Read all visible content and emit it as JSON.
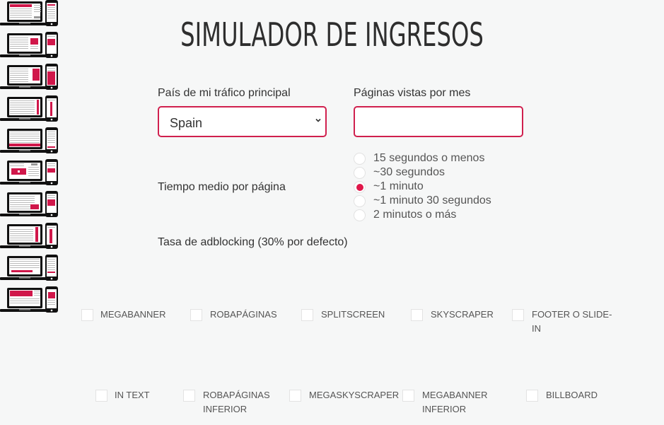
{
  "title": "SIMULADOR DE INGRESOS",
  "country": {
    "label": "País de mi tráfico principal",
    "selected": "Spain",
    "icon": "chevron-down-icon"
  },
  "pageviews": {
    "label": "Páginas vistas por mes",
    "value": "",
    "placeholder": ""
  },
  "time": {
    "label": "Tiempo medio por página",
    "options": [
      {
        "label": "15 segundos o menos",
        "checked": false
      },
      {
        "label": "~30 segundos",
        "checked": false
      },
      {
        "label": "~1 minuto",
        "checked": true
      },
      {
        "label": "~1 minuto 30 segundos",
        "checked": false
      },
      {
        "label": "2 minutos o más",
        "checked": false
      }
    ]
  },
  "adblock": {
    "label": "Tasa de adblocking (30% por defecto)"
  },
  "formats": [
    {
      "label": "MEGABANNER",
      "checked": false,
      "icon": "megabanner-devices-icon"
    },
    {
      "label": "ROBAPÁGINAS",
      "checked": false,
      "icon": "robapaginas-devices-icon"
    },
    {
      "label": "SPLITSCREEN",
      "checked": false,
      "icon": "splitscreen-devices-icon"
    },
    {
      "label": "SKYSCRAPER",
      "checked": false,
      "icon": "skyscraper-devices-icon"
    },
    {
      "label": "FOOTER O SLIDE-IN",
      "checked": false,
      "icon": "footer-devices-icon"
    },
    {
      "label": "IN TEXT",
      "checked": false,
      "icon": "intext-devices-icon"
    },
    {
      "label": "ROBAPÁGINAS INFERIOR",
      "checked": false,
      "icon": "robapaginas-inferior-devices-icon"
    },
    {
      "label": "MEGASKYSCRAPER",
      "checked": false,
      "icon": "megaskyscraper-devices-icon"
    },
    {
      "label": "MEGABANNER INFERIOR",
      "checked": false,
      "icon": "megabanner-inferior-devices-icon"
    },
    {
      "label": "BILLBOARD",
      "checked": false,
      "icon": "billboard-devices-icon"
    }
  ],
  "colors": {
    "accent": "#d0204e",
    "radio_checked": "#e0174a",
    "background": "#f6f7f7"
  }
}
